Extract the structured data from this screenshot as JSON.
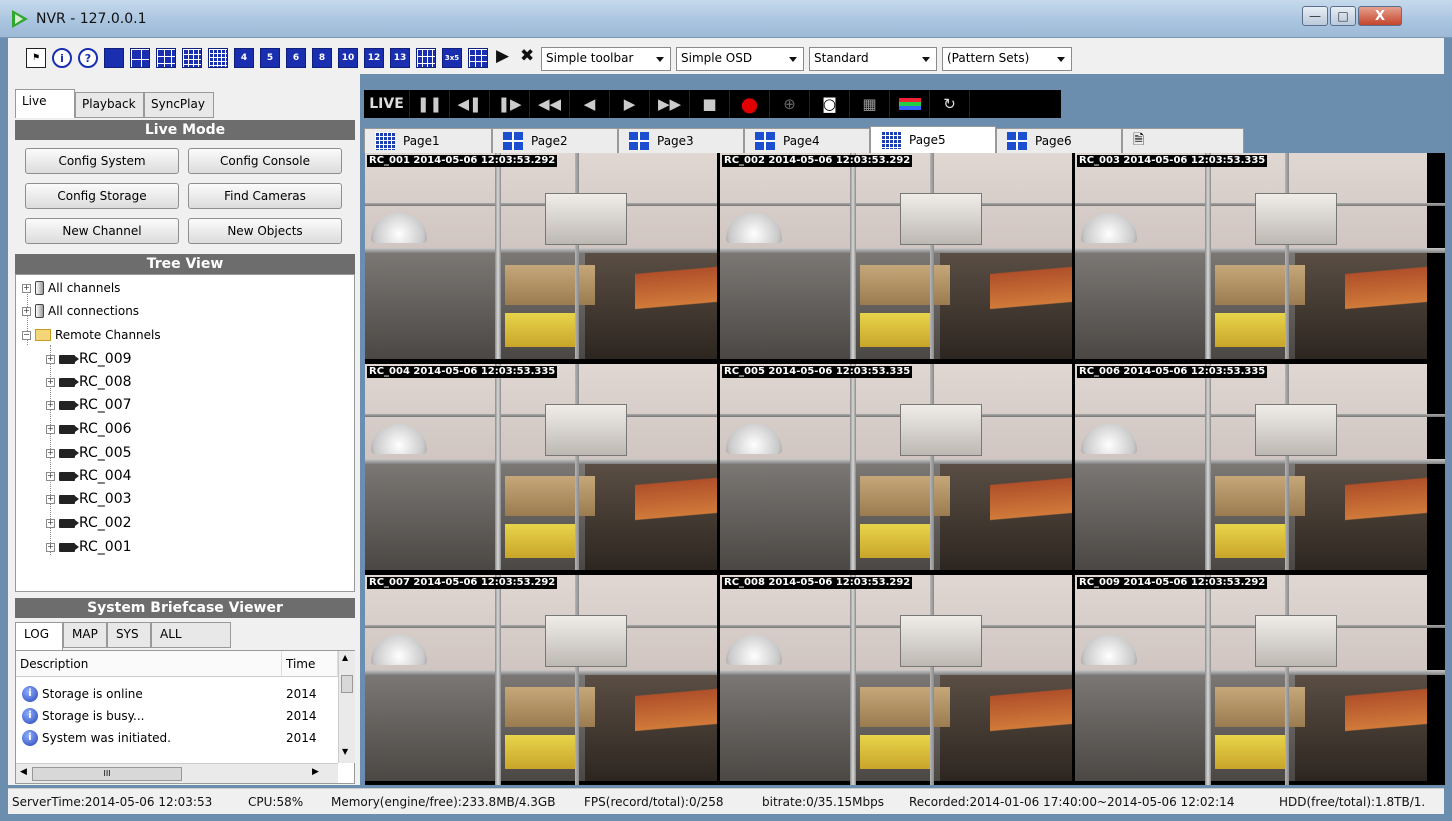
{
  "window": {
    "title": "NVR - 127.0.0.1",
    "controls": {
      "minimize": "—",
      "maximize": "□",
      "close": "X"
    }
  },
  "toolbar": {
    "icons": [
      "run-icon",
      "info-icon",
      "help-icon",
      "layout-1",
      "layout-4",
      "layout-9",
      "layout-16",
      "layout-25",
      "layout-4-alt",
      "layout-5",
      "layout-6",
      "layout-8",
      "layout-10",
      "layout-12",
      "layout-13",
      "layout-grid",
      "layout-3x5",
      "layout-custom"
    ],
    "layout_numbers": [
      "4",
      "5",
      "6",
      "8",
      "10",
      "12",
      "13",
      "3x5"
    ],
    "combos": {
      "toolbar_mode": "Simple toolbar",
      "osd_mode": "Simple OSD",
      "quality": "Standard",
      "pattern_sets": "(Pattern Sets)"
    }
  },
  "left": {
    "mode_tabs": [
      "Live",
      "Playback",
      "SyncPlay"
    ],
    "active_mode_tab": "Live",
    "live_mode_header": "Live Mode",
    "buttons": {
      "config_system": "Config System",
      "config_console": "Config Console",
      "config_storage": "Config Storage",
      "find_cameras": "Find Cameras",
      "new_channel": "New Channel",
      "new_objects": "New Objects"
    },
    "tree_header": "Tree View",
    "tree": {
      "all_channels": "All channels",
      "all_connections": "All connections",
      "remote_channels": "Remote Channels",
      "channels": [
        "RC_009",
        "RC_008",
        "RC_007",
        "RC_006",
        "RC_005",
        "RC_004",
        "RC_003",
        "RC_002",
        "RC_001"
      ]
    },
    "briefcase": {
      "header": "System Briefcase Viewer",
      "tabs": [
        "LOG",
        "MAP",
        "SYS",
        "ALL"
      ],
      "active_tab": "LOG",
      "columns": {
        "description": "Description",
        "time": "Time"
      },
      "rows": [
        {
          "description": "Storage is online",
          "time": "2014"
        },
        {
          "description": "Storage is busy...",
          "time": "2014"
        },
        {
          "description": "System was initiated.",
          "time": "2014"
        }
      ],
      "hscroll_grip": "III"
    }
  },
  "playback_bar": {
    "live_label": "LIVE",
    "buttons": [
      "pause",
      "step-back",
      "step-forward",
      "fast-rewind",
      "reverse-play",
      "play",
      "fast-forward",
      "stop",
      "record",
      "zoom",
      "snapshot",
      "grid",
      "color",
      "refresh"
    ]
  },
  "page_tabs": {
    "tabs": [
      "Page1",
      "Page2",
      "Page3",
      "Page4",
      "Page5",
      "Page6"
    ],
    "active": "Page5",
    "new_tab_icon": "new-page-icon"
  },
  "cameras": [
    {
      "label": "RC_001 2014-05-06 12:03:53.292"
    },
    {
      "label": "RC_002 2014-05-06 12:03:53.292"
    },
    {
      "label": "RC_003 2014-05-06 12:03:53.335"
    },
    {
      "label": "RC_004 2014-05-06 12:03:53.335"
    },
    {
      "label": "RC_005 2014-05-06 12:03:53.335"
    },
    {
      "label": "RC_006 2014-05-06 12:03:53.335"
    },
    {
      "label": "RC_007 2014-05-06 12:03:53.292"
    },
    {
      "label": "RC_008 2014-05-06 12:03:53.292"
    },
    {
      "label": "RC_009 2014-05-06 12:03:53.292"
    }
  ],
  "status": {
    "server_time": "ServerTime:2014-05-06 12:03:53",
    "cpu": "CPU:58%",
    "memory": "Memory(engine/free):233.8MB/4.3GB",
    "fps": "FPS(record/total):0/258",
    "bitrate": "bitrate:0/35.15Mbps",
    "recorded": "Recorded:2014-01-06 17:40:00~2014-05-06 12:02:14",
    "hdd": "HDD(free/total):1.8TB/1."
  },
  "colors": {
    "titlebar": "#a9c4df",
    "section_header": "#6d6d6d",
    "layout_icon_blue": "#1a2fb0",
    "record_red": "#e00000",
    "playbar_bg": "#000000"
  }
}
